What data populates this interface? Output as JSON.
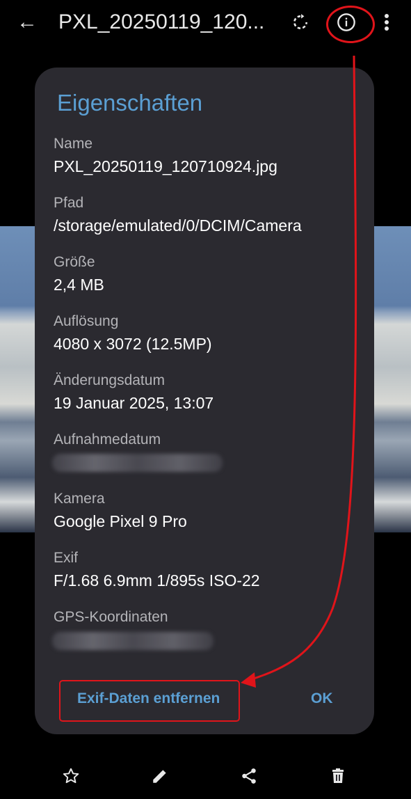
{
  "topbar": {
    "back_glyph": "←",
    "title": "PXL_20250119_120...",
    "icons": [
      "arrow-back-icon",
      "rotate-icon",
      "info-icon",
      "more-vert-icon"
    ]
  },
  "dialog": {
    "title": "Eigenschaften",
    "properties": [
      {
        "label": "Name",
        "value": "PXL_20250119_120710924.jpg"
      },
      {
        "label": "Pfad",
        "value": "/storage/emulated/0/DCIM/Camera"
      },
      {
        "label": "Größe",
        "value": "2,4 MB"
      },
      {
        "label": "Auflösung",
        "value": "4080 x 3072 (12.5MP)"
      },
      {
        "label": "Änderungsdatum",
        "value": "19 Januar 2025, 13:07"
      },
      {
        "label": "Aufnahmedatum",
        "value": ""
      },
      {
        "label": "Kamera",
        "value": "Google Pixel 9 Pro"
      },
      {
        "label": "Exif",
        "value": "F/1.68  6.9mm  1/895s  ISO-22"
      },
      {
        "label": "GPS-Koordinaten",
        "value": ""
      }
    ],
    "buttons": {
      "remove_exif": "Exif-Daten entfernen",
      "ok": "OK"
    }
  },
  "bottombar": {
    "icons": [
      "star-icon",
      "edit-icon",
      "share-icon",
      "delete-icon"
    ]
  },
  "colors": {
    "accent": "#5b9fd3",
    "dialog_bg": "#2b2a30",
    "annotation": "#e0141a"
  }
}
